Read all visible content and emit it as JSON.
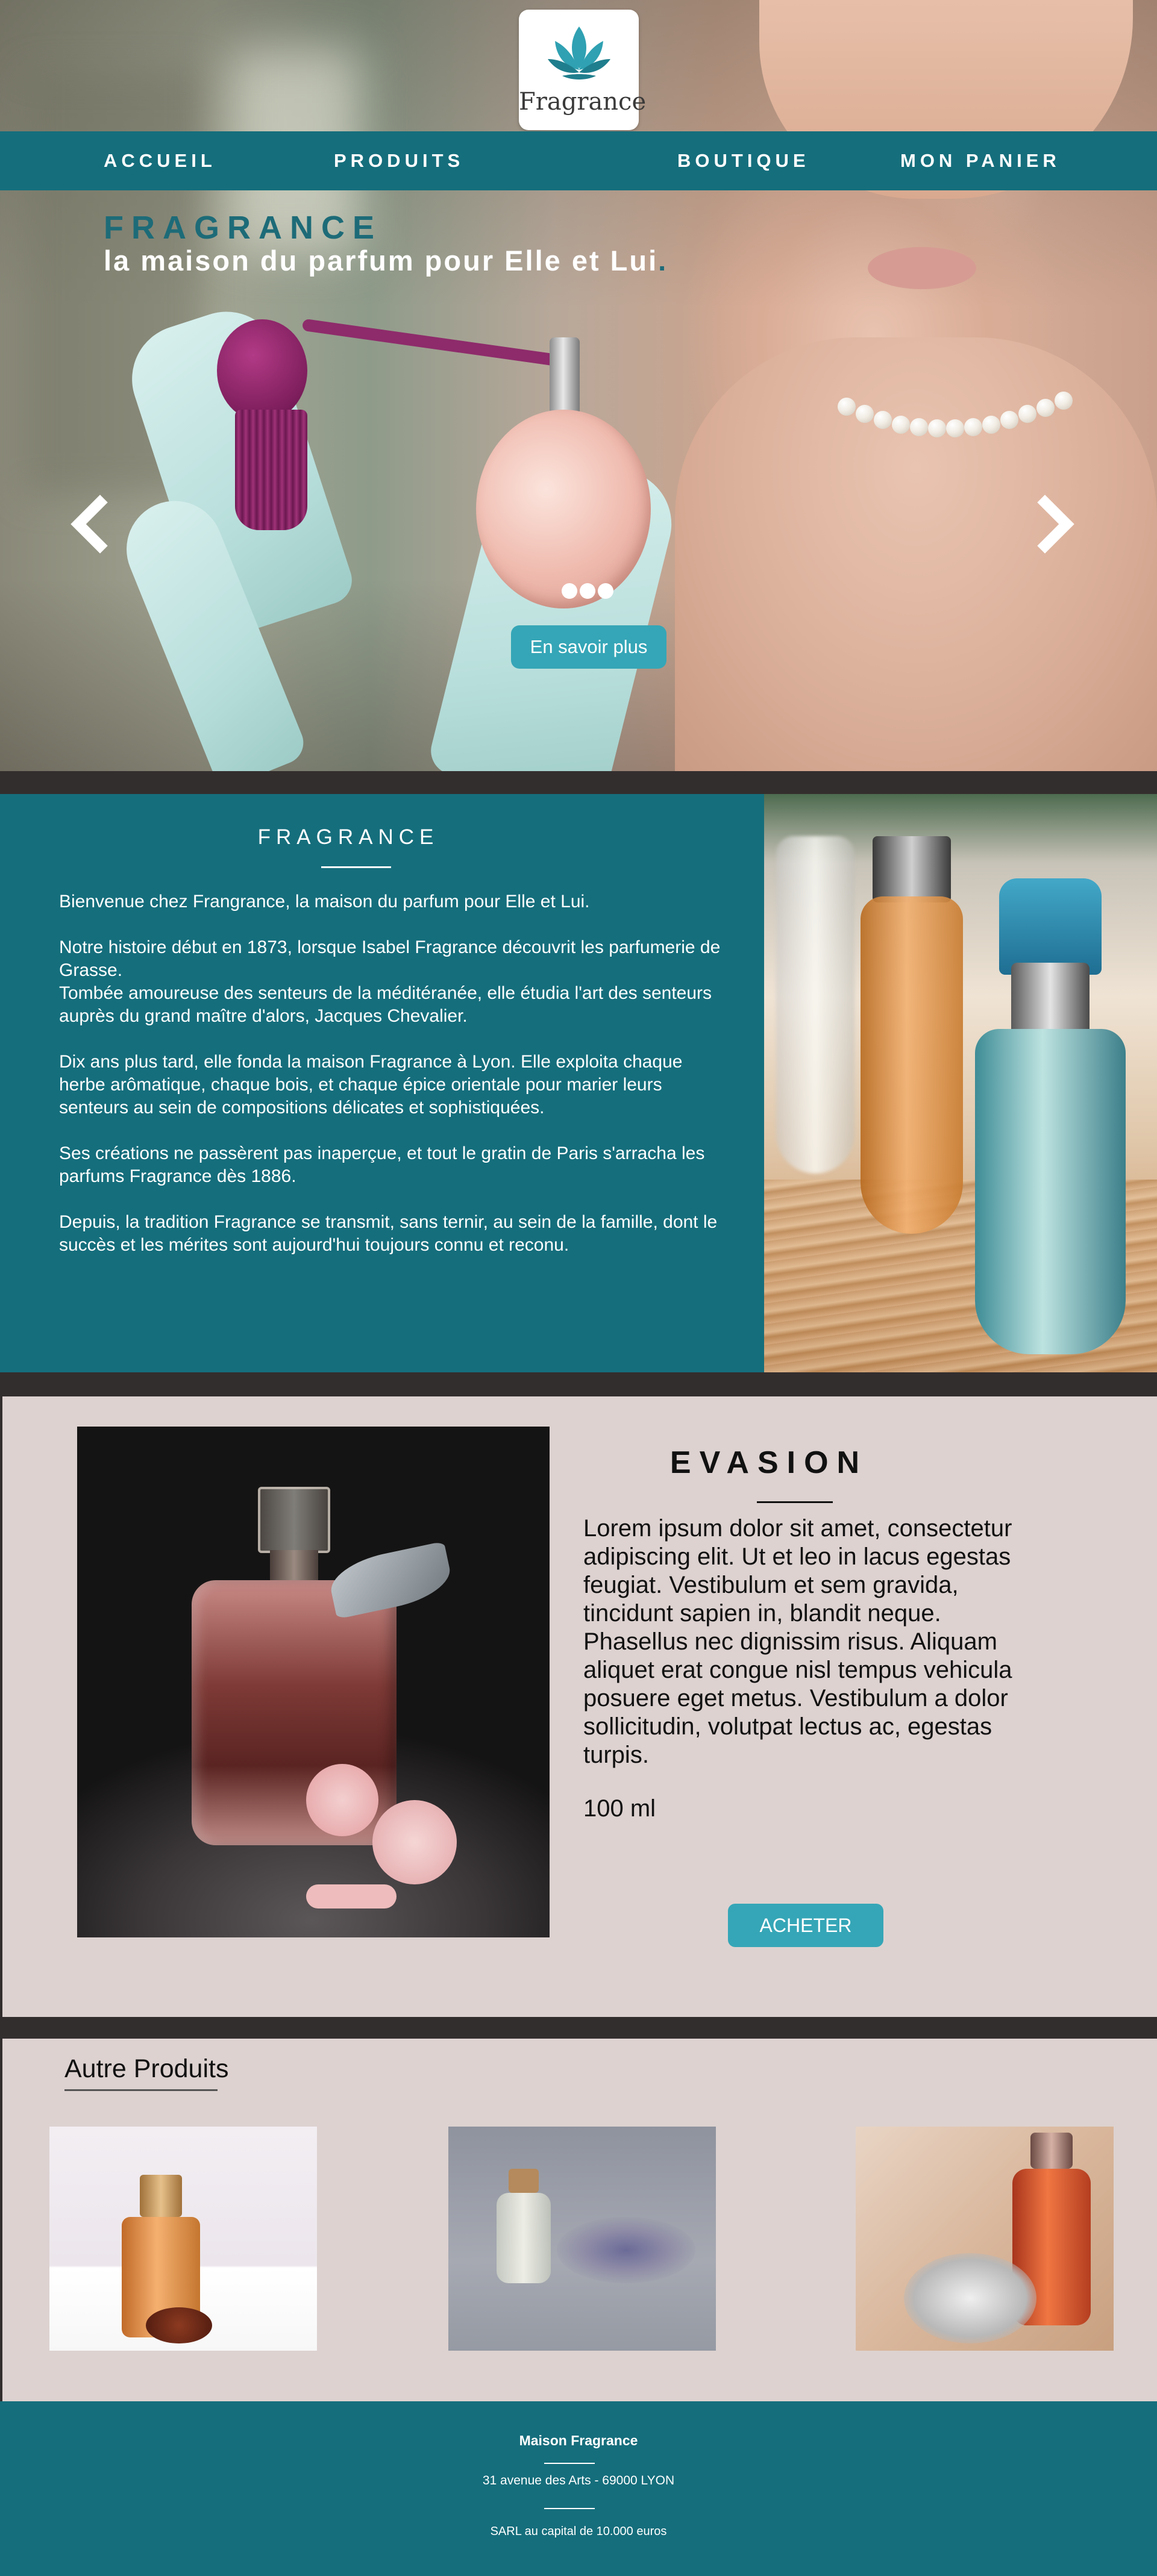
{
  "brand": {
    "logo_text": "Fragrance",
    "accent_color": "#156e7c",
    "button_color": "#35a6b7"
  },
  "nav": {
    "items": [
      {
        "label": "ACCUEIL"
      },
      {
        "label": "PRODUITS"
      },
      {
        "label": "BOUTIQUE"
      },
      {
        "label": "MON PANIER"
      }
    ]
  },
  "hero": {
    "title": "FRAGRANCE",
    "subtitle": "la maison du parfum pour Elle et Lui",
    "subtitle_end": ".",
    "prev_icon": "chevron-left-icon",
    "next_icon": "chevron-right-icon",
    "slides_count": 3,
    "cta_label": "En savoir plus"
  },
  "about": {
    "heading": "FRAGRANCE",
    "paragraphs": [
      "Bienvenue chez Frangrance, la maison du parfum pour Elle et Lui.",
      "Notre histoire début en 1873, lorsque Isabel Fragrance découvrit les parfumerie de Grasse.\nTombée amoureuse des senteurs de la méditéranée, elle étudia l'art des senteurs auprès du grand maître d'alors, Jacques Chevalier.",
      "Dix ans plus tard, elle fonda la maison Fragrance à Lyon. Elle exploita chaque herbe arômatique, chaque bois, et chaque épice orientale pour marier leurs senteurs au sein de compositions délicates et sophistiquées.",
      "Ses créations ne passèrent pas inaperçue, et tout le gratin de Paris s'arracha les parfums Fragrance dès 1886.",
      "Depuis, la tradition Fragrance se transmit, sans ternir, au sein de la famille, dont le succès et les mérites sont aujourd'hui toujours connu et reconu."
    ]
  },
  "product": {
    "name": "EVASION",
    "description": "Lorem ipsum dolor sit amet, consectetur adipiscing elit. Ut et leo in lacus egestas feugiat. Vestibulum et sem gravida, tincidunt sapien in, blandit neque. Phasellus nec dignissim risus. Aliquam aliquet erat congue nisl tempus vehicula posuere eget metus. Vestibulum a dolor sollicitudin, volutpat lectus ac, egestas turpis.",
    "volume": "100 ml",
    "buy_label": "ACHETER"
  },
  "others": {
    "title": "Autre Produits"
  },
  "footer": {
    "name": "Maison Fragrance",
    "address": "31 avenue des Arts - 69000 LYON",
    "legal": "SARL au capital de 10.000 euros"
  }
}
